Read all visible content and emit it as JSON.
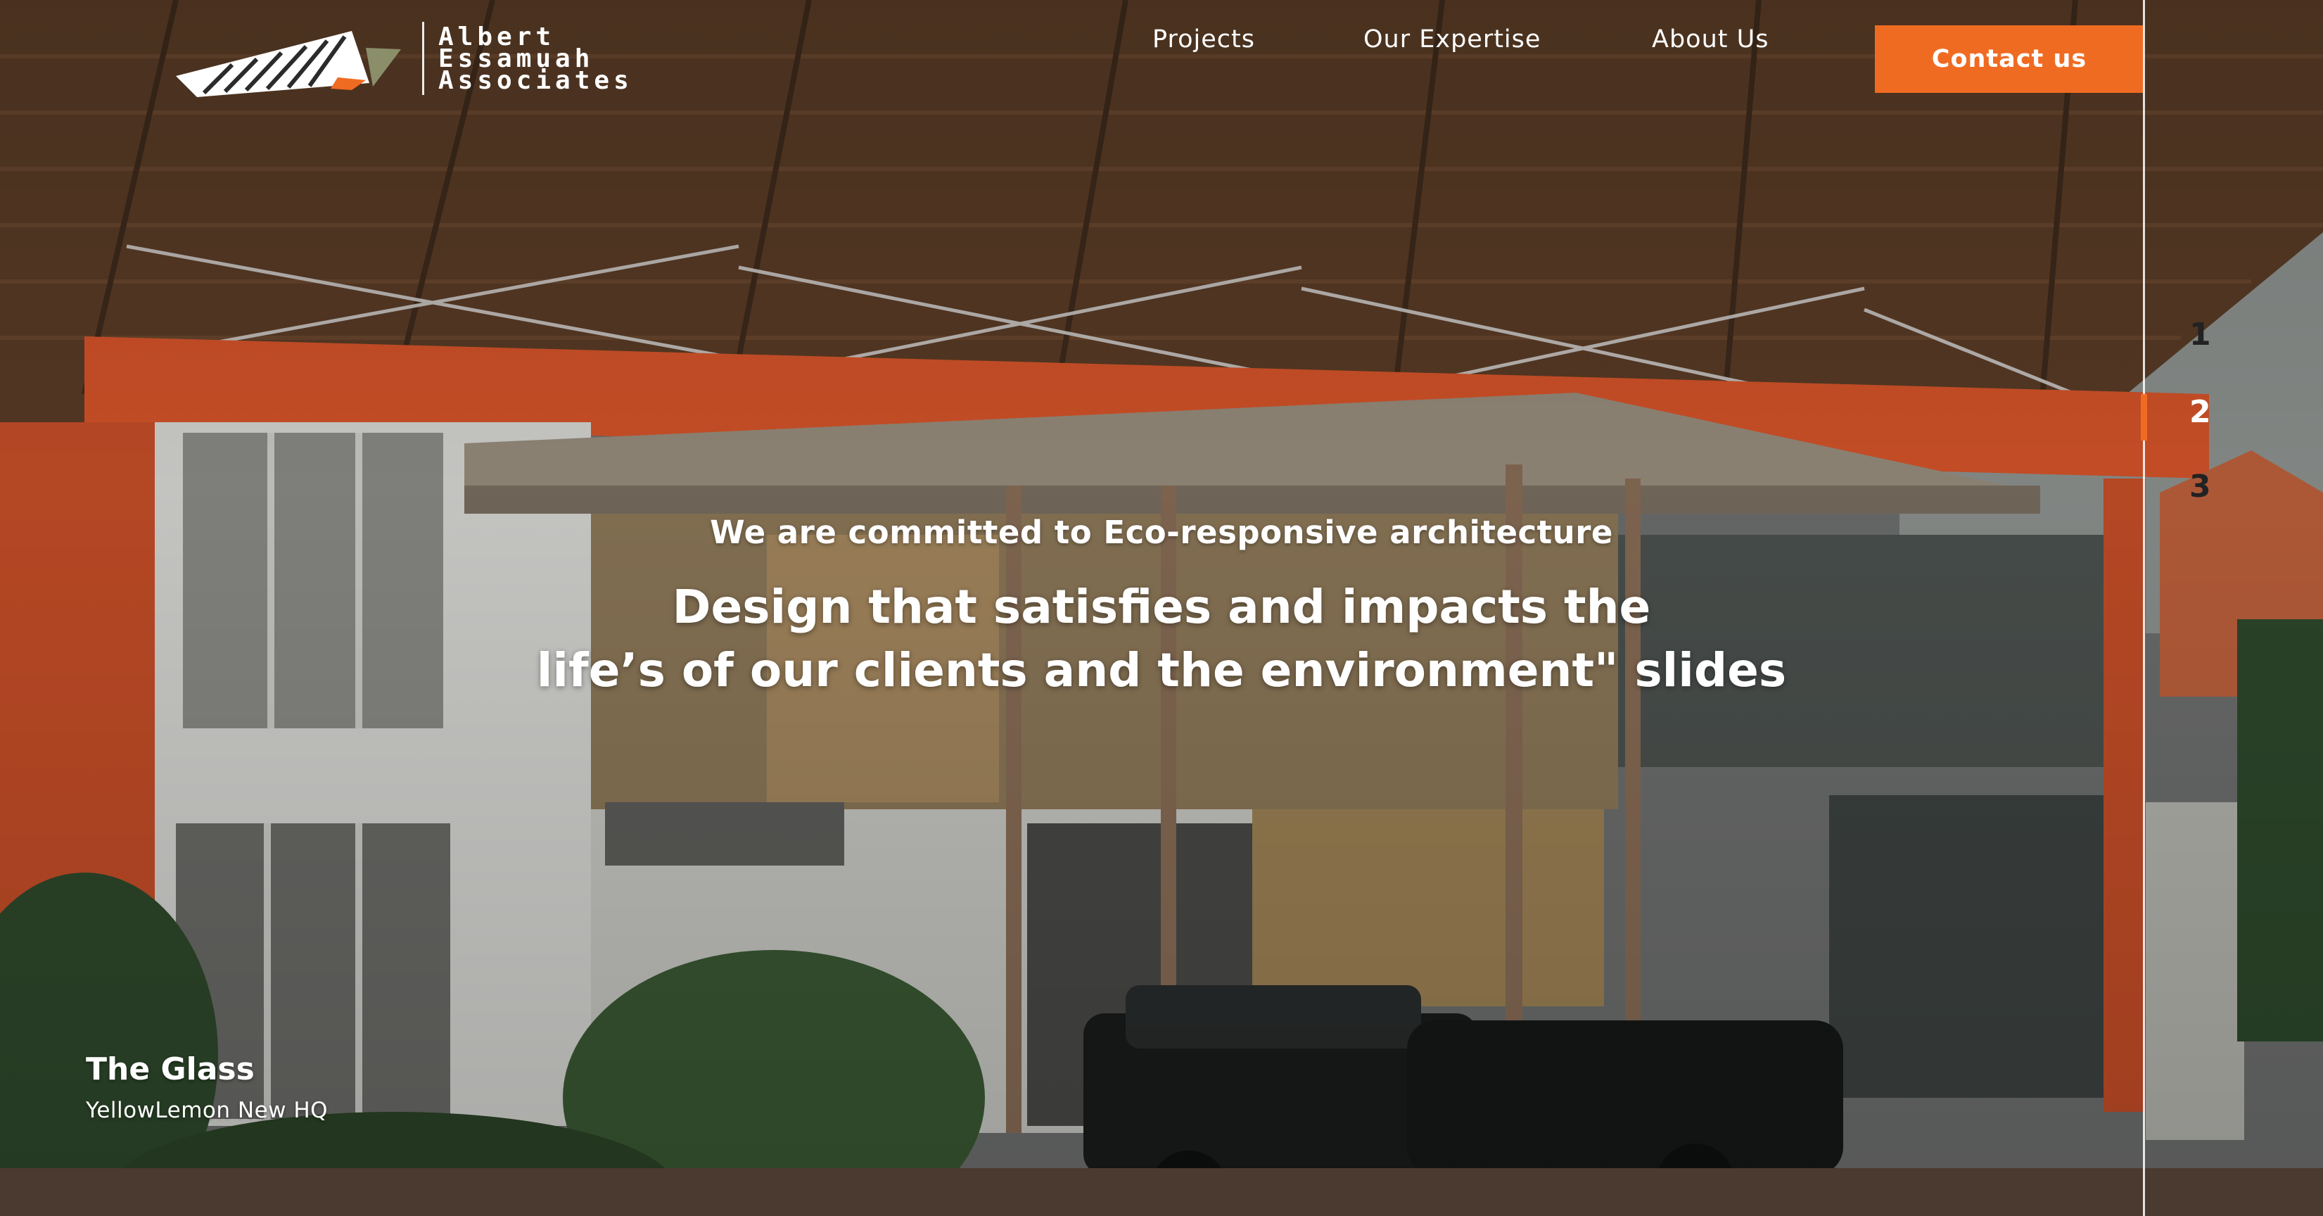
{
  "brand": {
    "name_lines": [
      "Albert",
      "Essamuah",
      "Associates"
    ],
    "logo_icon": "roof-logo-icon",
    "accent_color": "#f06b22"
  },
  "nav": {
    "projects": "Projects",
    "expertise": "Our Expertise",
    "about": "About Us",
    "contact": "Contact us"
  },
  "slider": {
    "slides": [
      "1",
      "2",
      "3"
    ],
    "active_slide": 2
  },
  "hero": {
    "eyebrow": "We are committed to Eco-responsive architecture",
    "headline_line1": "Design that satisfies and impacts the",
    "headline_line2": "life’s of our clients and the environment\" slides"
  },
  "project": {
    "title": "The Glass",
    "subtitle": "YellowLemon New HQ"
  }
}
